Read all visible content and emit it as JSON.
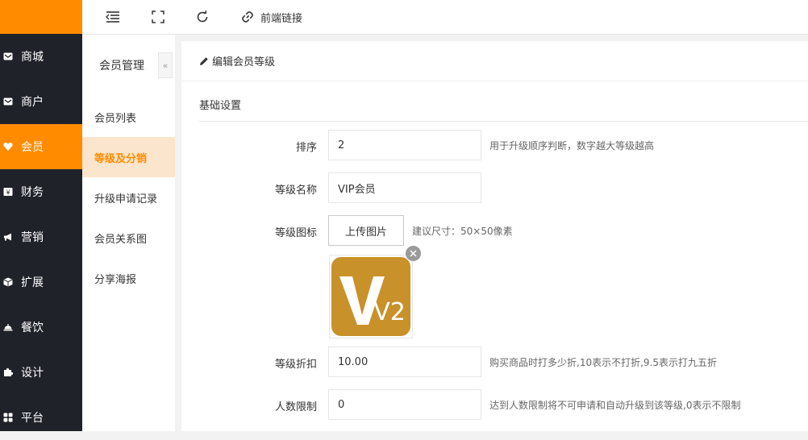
{
  "topbar": {
    "frontend_link_label": "前端链接"
  },
  "nav": {
    "items": [
      {
        "label": "商城"
      },
      {
        "label": "商户"
      },
      {
        "label": "会员"
      },
      {
        "label": "财务"
      },
      {
        "label": "营销"
      },
      {
        "label": "扩展"
      },
      {
        "label": "餐饮"
      },
      {
        "label": "设计"
      },
      {
        "label": "平台"
      }
    ],
    "active_index": 2
  },
  "sub_nav": {
    "title": "会员管理",
    "items": [
      {
        "label": "会员列表"
      },
      {
        "label": "等级及分销"
      },
      {
        "label": "升级申请记录"
      },
      {
        "label": "会员关系图"
      },
      {
        "label": "分享海报"
      }
    ],
    "active_index": 1
  },
  "panel": {
    "title": "编辑会员等级",
    "section_title": "基础设置",
    "fields": {
      "sort": {
        "label": "排序",
        "value": "2",
        "tip": "用于升级顺序判断，数字越大等级越高"
      },
      "name": {
        "label": "等级名称",
        "value": "VIP会员"
      },
      "icon": {
        "label": "等级图标",
        "button": "上传图片",
        "tip": "建议尺寸：50×50像素",
        "image_text": "V2"
      },
      "discount": {
        "label": "等级折扣",
        "value": "10.00",
        "tip": "购买商品时打多少折,10表示不打折,9.5表示打九五折"
      },
      "limit": {
        "label": "人数限制",
        "value": "0",
        "tip": "达到人数限制将不可申请和自动升级到该等级,0表示不限制"
      }
    }
  },
  "colors": {
    "accent": "#ff8c00",
    "sidebar": "#20222a",
    "icon_gold": "#c8912a",
    "sub_active_bg": "#fbe5cc"
  }
}
